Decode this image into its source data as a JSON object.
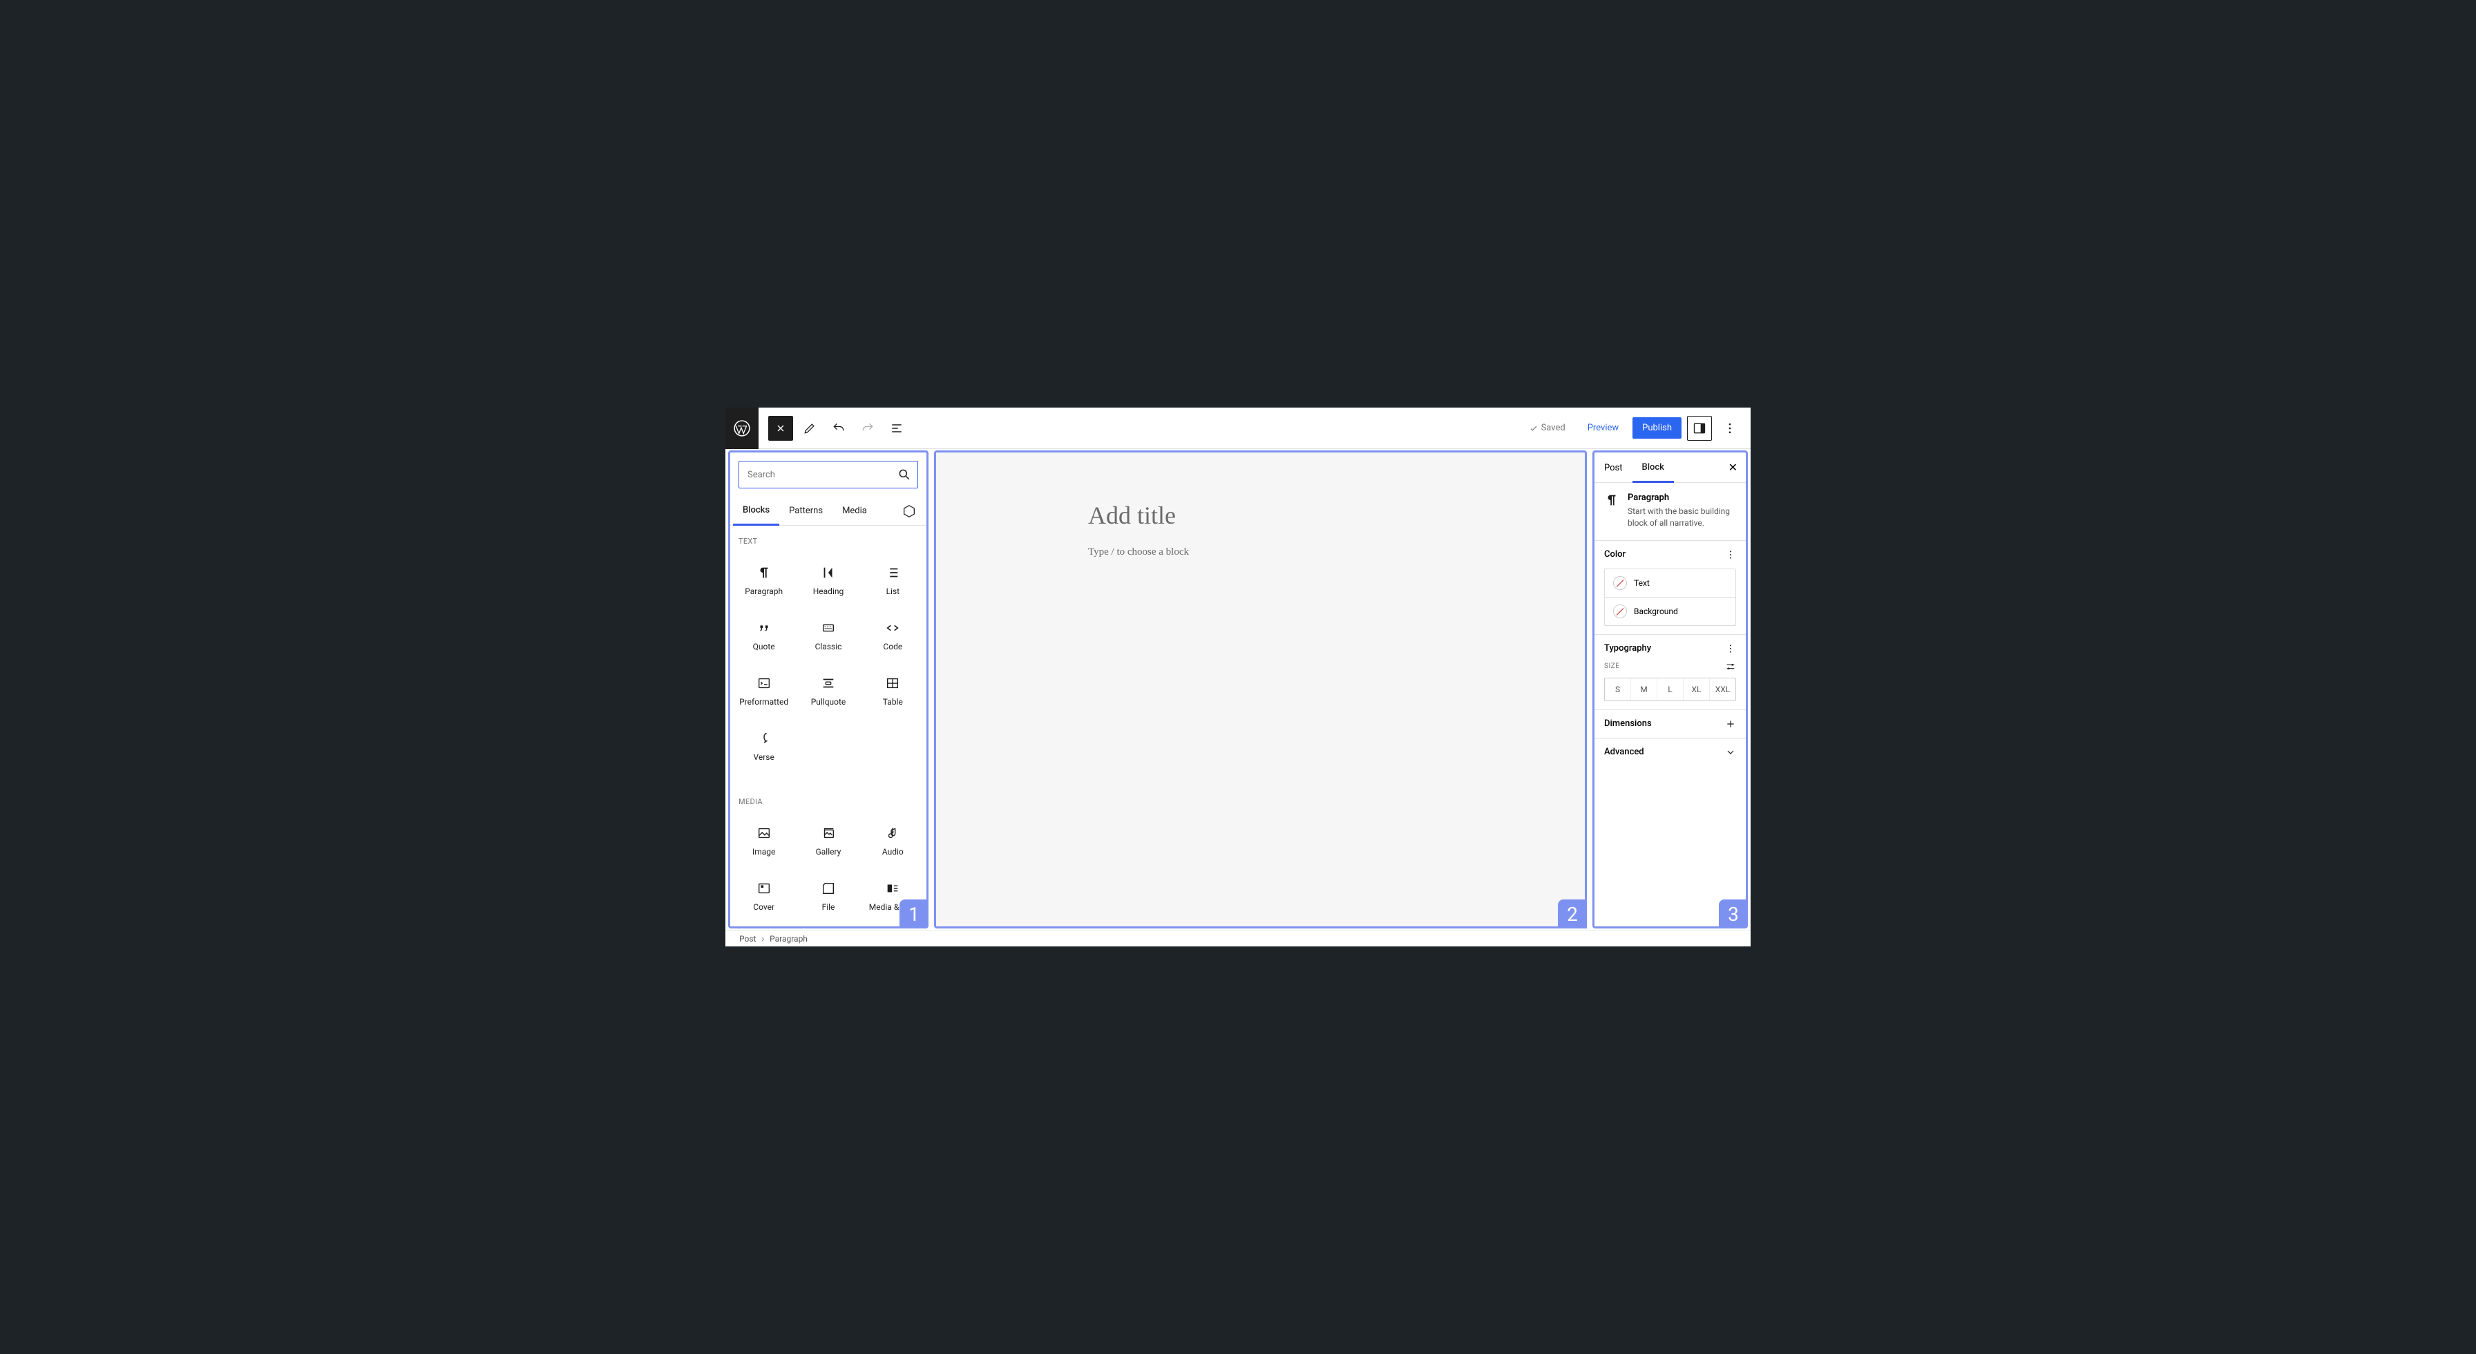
{
  "topbar": {
    "saved": "Saved",
    "preview": "Preview",
    "publish": "Publish"
  },
  "inserter": {
    "search_placeholder": "Search",
    "tabs": [
      "Blocks",
      "Patterns",
      "Media"
    ],
    "cat_text": "TEXT",
    "cat_media": "MEDIA",
    "text_blocks": [
      "Paragraph",
      "Heading",
      "List",
      "Quote",
      "Classic",
      "Code",
      "Preformatted",
      "Pullquote",
      "Table",
      "Verse"
    ],
    "media_blocks": [
      "Image",
      "Gallery",
      "Audio",
      "Cover",
      "File",
      "Media & Text"
    ]
  },
  "canvas": {
    "title_placeholder": "Add title",
    "body_placeholder": "Type / to choose a block"
  },
  "settings": {
    "tabs": [
      "Post",
      "Block"
    ],
    "block_name": "Paragraph",
    "block_desc": "Start with the basic building block of all narrative.",
    "color_label": "Color",
    "color_text": "Text",
    "color_bg": "Background",
    "typo_label": "Typography",
    "size_label": "SIZE",
    "sizes": [
      "S",
      "M",
      "L",
      "XL",
      "XXL"
    ],
    "dimensions": "Dimensions",
    "advanced": "Advanced"
  },
  "breadcrumbs": [
    "Post",
    "Paragraph"
  ],
  "badges": {
    "one": "1",
    "two": "2",
    "three": "3"
  }
}
